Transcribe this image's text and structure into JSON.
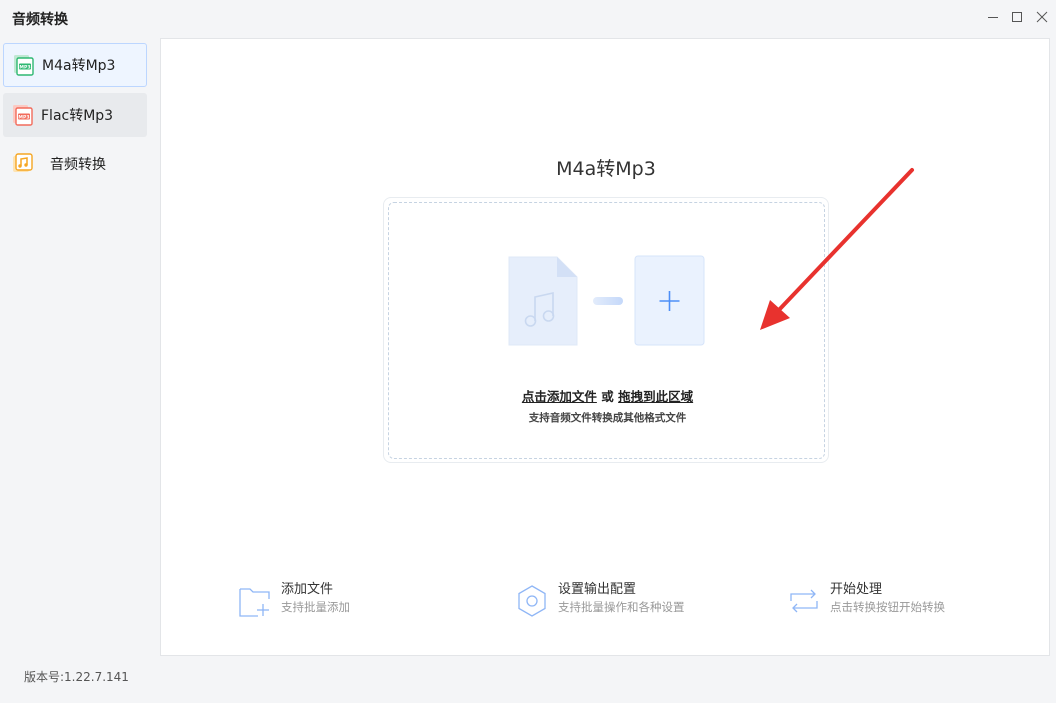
{
  "window": {
    "title": "音频转换"
  },
  "sidebar": {
    "items": [
      {
        "label": "M4a转Mp3",
        "icon": "mp3-file-icon",
        "state": "active",
        "accent": "#2eb872"
      },
      {
        "label": "Flac转Mp3",
        "icon": "mp3-file-icon",
        "state": "hover",
        "accent": "#f26b5b"
      },
      {
        "label": "音频转换",
        "icon": "music-convert-icon",
        "state": "normal",
        "accent": "#f5a623"
      }
    ],
    "version": "版本号:1.22.7.141"
  },
  "main": {
    "title": "M4a转Mp3",
    "drop_zone": {
      "add_link": "点击添加文件",
      "or_text": "或",
      "drag_link": "拖拽到此区域",
      "subtitle": "支持音频文件转换成其他格式文件"
    },
    "features": [
      {
        "title": "添加文件",
        "desc": "支持批量添加",
        "icon": "add-folder-icon"
      },
      {
        "title": "设置输出配置",
        "desc": "支持批量操作和各种设置",
        "icon": "settings-gear-icon"
      },
      {
        "title": "开始处理",
        "desc": "点击转换按钮开始转换",
        "icon": "convert-cycle-icon"
      }
    ]
  },
  "colors": {
    "accent_blue": "#4d8ff7",
    "annotation_arrow": "#e8322e"
  }
}
